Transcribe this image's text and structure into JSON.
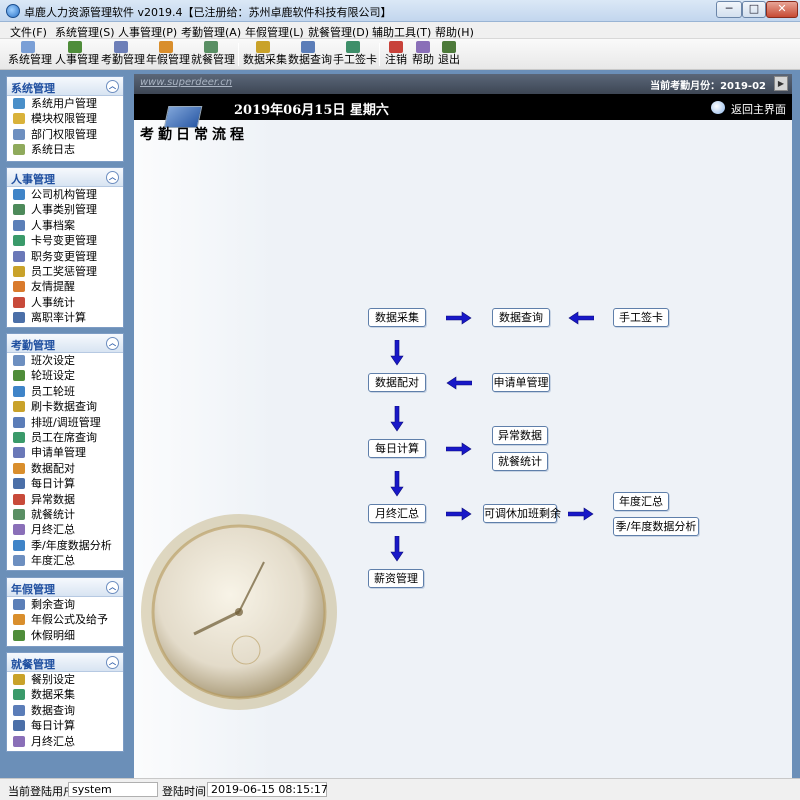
{
  "window": {
    "title": "卓鹿人力资源管理软件 v2019.4【已注册给：苏州卓鹿软件科技有限公司】",
    "minimize": "─",
    "maximize": "□",
    "close": "✕"
  },
  "menu": [
    "文件(F)",
    "系统管理(S)",
    "人事管理(P)",
    "考勤管理(A)",
    "年假管理(L)",
    "就餐管理(D)",
    "辅助工具(T)",
    "帮助(H)"
  ],
  "toolbar": [
    {
      "label": "系统管理",
      "icon": "system-icon",
      "color": "#7a9fd6"
    },
    {
      "label": "人事管理",
      "icon": "users-icon",
      "color": "#4f8d3a"
    },
    {
      "label": "考勤管理",
      "icon": "attendance-icon",
      "color": "#6d7fb8"
    },
    {
      "label": "年假管理",
      "icon": "calendar-icon",
      "color": "#d98e2c"
    },
    {
      "label": "就餐管理",
      "icon": "dining-icon",
      "color": "#5a8f64"
    },
    {
      "label": "数据采集",
      "icon": "collect-icon",
      "color": "#c9a22a"
    },
    {
      "label": "数据查询",
      "icon": "query-icon",
      "color": "#5b7db8"
    },
    {
      "label": "手工签卡",
      "icon": "sign-card-icon",
      "color": "#3e8f6a"
    },
    {
      "label": "注销",
      "icon": "logout-icon",
      "color": "#c8423a"
    },
    {
      "label": "帮助",
      "icon": "help-icon",
      "color": "#8a6fb8"
    },
    {
      "label": "退出",
      "icon": "exit-icon",
      "color": "#4d7a3a"
    }
  ],
  "sidebar": {
    "system": {
      "title": "系统管理",
      "items": [
        "系统用户管理",
        "模块权限管理",
        "部门权限管理",
        "系统日志"
      ]
    },
    "hr": {
      "title": "人事管理",
      "items": [
        "公司机构管理",
        "人事类别管理",
        "人事档案",
        "卡号变更管理",
        "职务变更管理",
        "员工奖惩管理",
        "友情提醒",
        "人事统计",
        "离职率计算"
      ]
    },
    "attendance": {
      "title": "考勤管理",
      "items": [
        "班次设定",
        "轮班设定",
        "员工轮班",
        "刷卡数据查询",
        "排班/调班管理",
        "员工在席查询",
        "申请单管理",
        "数据配对",
        "每日计算",
        "异常数据",
        "就餐统计",
        "月终汇总",
        "季/年度数据分析",
        "年度汇总"
      ]
    },
    "leave": {
      "title": "年假管理",
      "items": [
        "剩余查询",
        "年假公式及给予",
        "休假明细"
      ]
    },
    "dining": {
      "title": "就餐管理",
      "items": [
        "餐别设定",
        "数据采集",
        "数据查询",
        "每日计算",
        "月终汇总"
      ]
    }
  },
  "main": {
    "website": "www.superdeer.cn",
    "current_month": "当前考勤月份：2019-02",
    "date": "2019年06月15日  星期六",
    "return_label": "返回主界面",
    "flow_title": "考勤日常流程"
  },
  "flow": {
    "collect": "数据采集",
    "query": "数据查询",
    "manual_card": "手工签卡",
    "pairing": "数据配对",
    "requests": "申请单管理",
    "daily_calc": "每日计算",
    "abnormal": "异常数据",
    "dining_stats": "就餐统计",
    "monthly": "月终汇总",
    "comp_leave": "可调休加班剩余",
    "annual": "年度汇总",
    "quarter_annual": "季/年度数据分析",
    "payroll": "薪资管理"
  },
  "status": {
    "user_label": "当前登陆用户",
    "user": "system",
    "login_label": "登陆时间",
    "login_time": "2019-06-15 08:15:17"
  }
}
